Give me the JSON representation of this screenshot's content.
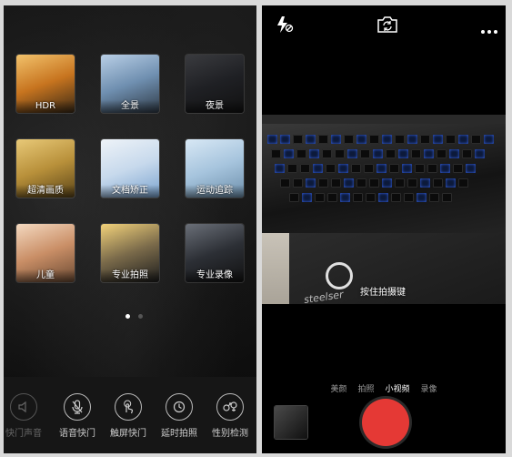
{
  "left_screen": {
    "modes": [
      {
        "label": "HDR",
        "icon": "hdr-sunset-icon",
        "gradient": [
          "#f2c26b",
          "#c7741f",
          "#3b2a16"
        ]
      },
      {
        "label": "全景",
        "icon": "panorama-city-icon",
        "gradient": [
          "#b9cfe6",
          "#6f8fb0",
          "#2f3a46"
        ]
      },
      {
        "label": "夜景",
        "icon": "night-scene-icon",
        "gradient": [
          "#3a3b3f",
          "#1f2024",
          "#111"
        ]
      },
      {
        "label": "超清画质",
        "icon": "wheat-field-icon",
        "gradient": [
          "#e8c978",
          "#b8903a",
          "#5a4418"
        ]
      },
      {
        "label": "文档矫正",
        "icon": "document-card-icon",
        "gradient": [
          "#eef3f8",
          "#c7d9ec",
          "#7aa3cf"
        ]
      },
      {
        "label": "运动追踪",
        "icon": "airplane-icon",
        "gradient": [
          "#d8e8f5",
          "#a6c4dd",
          "#6d8fab"
        ]
      },
      {
        "label": "儿童",
        "icon": "child-portrait-icon",
        "gradient": [
          "#f4d9c0",
          "#c98e66",
          "#6b4a33"
        ]
      },
      {
        "label": "专业拍照",
        "icon": "pro-camera-icon",
        "gradient": [
          "#f2d27a",
          "#7a6a4a",
          "#1d1d1d"
        ]
      },
      {
        "label": "专业录像",
        "icon": "pro-video-icon",
        "gradient": [
          "#6a6f78",
          "#2c2f35",
          "#111"
        ]
      }
    ],
    "page_dots": {
      "count": 2,
      "active_index": 0
    },
    "shortcuts": [
      {
        "label": "快门声音",
        "icon": "speaker-icon",
        "dim": true
      },
      {
        "label": "语音快门",
        "icon": "microphone-icon",
        "dim": false
      },
      {
        "label": "触屏快门",
        "icon": "touch-hand-icon",
        "dim": false
      },
      {
        "label": "延时拍照",
        "icon": "timer-icon",
        "dim": false
      },
      {
        "label": "性别检测",
        "icon": "gender-icon",
        "dim": false
      }
    ]
  },
  "right_screen": {
    "hint": "按住拍摄键",
    "modes": [
      {
        "label": "美颜",
        "active": false
      },
      {
        "label": "拍照",
        "active": false
      },
      {
        "label": "小视频",
        "active": true
      },
      {
        "label": "录像",
        "active": false
      }
    ],
    "logo_text": "steelser",
    "colors": {
      "shutter": "#e53935"
    }
  }
}
